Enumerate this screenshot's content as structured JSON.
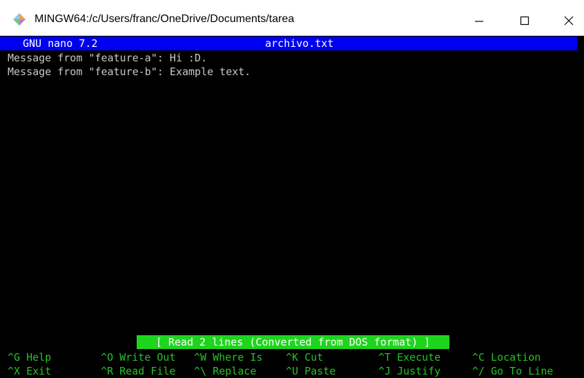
{
  "window": {
    "title": "MINGW64:/c/Users/franc/OneDrive/Documents/tarea",
    "icon": "git-mingw-icon",
    "controls": {
      "minimize": "minimize-icon",
      "maximize": "maximize-icon",
      "close": "close-icon"
    }
  },
  "nano": {
    "version": "GNU nano 7.2",
    "filename": "archivo.txt",
    "lines": [
      "Message from \"feature-a\": Hi :D.",
      "Message from \"feature-b\": Example text."
    ],
    "status": "[ Read 2 lines (Converted from DOS format) ]",
    "shortcuts": [
      [
        {
          "key": "^G",
          "label": "Help"
        },
        {
          "key": "^O",
          "label": "Write Out"
        },
        {
          "key": "^W",
          "label": "Where Is"
        },
        {
          "key": "^K",
          "label": "Cut"
        },
        {
          "key": "^T",
          "label": "Execute"
        },
        {
          "key": "^C",
          "label": "Location"
        }
      ],
      [
        {
          "key": "^X",
          "label": "Exit"
        },
        {
          "key": "^R",
          "label": "Read File"
        },
        {
          "key": "^\\",
          "label": "Replace"
        },
        {
          "key": "^U",
          "label": "Paste"
        },
        {
          "key": "^J",
          "label": "Justify"
        },
        {
          "key": "^/",
          "label": "Go To Line"
        }
      ]
    ]
  },
  "colors": {
    "header_bg": "#0000f0",
    "status_bg": "#1ed51e",
    "shortcut_text": "#25c325",
    "terminal_bg": "#000000",
    "text": "#c8c8c8"
  }
}
